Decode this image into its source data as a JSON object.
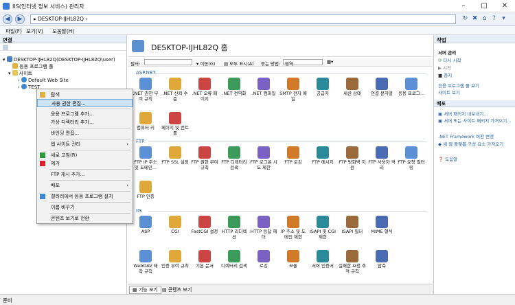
{
  "window": {
    "title": "IIS(인터넷 정보 서비스) 관리자",
    "minimize": "–",
    "maximize": "□",
    "close": "✕"
  },
  "address": {
    "path": "DESKTOP-IJHL82Q"
  },
  "menu": [
    "파일(F)",
    "보기(V)",
    "도움말(H)"
  ],
  "left": {
    "header": "연결",
    "tree": [
      "DESKTOP-IJHL82Q(DESKTOP-IJHL82Q\\user)",
      "응용 프로그램 풀",
      "사이트",
      "Default Web Site",
      "TEST"
    ]
  },
  "context_menu": [
    "탐색",
    "사용 권한 편집...",
    "응용 프로그램 추가...",
    "가상 디렉터리 추가...",
    "바인딩 편집...",
    "웹 사이트 관리",
    "새로 고침(R)",
    "제거",
    "FTP 게시 추가...",
    "배포",
    "갤러리에서 응용 프로그램 설치",
    "이름 바꾸기",
    "콘텐츠 보기로 전환"
  ],
  "center": {
    "title": "DESKTOP-IJHL82Q 홈",
    "filter": {
      "label": "필터:",
      "go": "이동(G)",
      "showall": "모두 표시(A)",
      "group_label": "묶는 방법:",
      "group_value": "영역"
    },
    "groups": {
      "aspnet": "ASP.NET",
      "ftp": "FTP",
      "iis": "IIS"
    },
    "aspnet_items": [
      ".NET 권한 부여 규칙",
      ".NET 신뢰 수준",
      ".NET 오류 페이지",
      ".NET 전역화",
      ".NET 컴파일",
      "SMTP 전자 메일",
      "공급자",
      "세션 상태",
      "연결 문자열",
      "응용 프로그...",
      "컴퓨터 키",
      "페이지 및 컨트롤"
    ],
    "ftp_items": [
      "FTP IP 주소 및 도메인...",
      "FTP SSL 설정",
      "FTP 권한 부여 규칙",
      "FTP 디렉터리 검색",
      "FTP 로그온 시도 제한",
      "FTP 로깅",
      "FTP 메시지",
      "FTP 방화벽 지원",
      "FTP 사용자 격리",
      "FTP 요청 필터링",
      "FTP 인증"
    ],
    "iis_items": [
      "ASP",
      "CGI",
      "FastCGI 설정",
      "HTTP 리디렉션",
      "HTTP 응답 헤더",
      "IP 주소 및 도메인 제한",
      "ISAPI 및 CGI 제한",
      "ISAPI 필터",
      "MIME 형식",
      "WebDAV 제작 규칙",
      "인증 부여 규칙",
      "기본 문서",
      "디렉터리 검색",
      "로깅",
      "모듈",
      "서버 인증서",
      "실패한 요청 추적 규칙",
      "압축"
    ],
    "tabs": [
      "기능 보기",
      "콘텐츠 보기"
    ]
  },
  "right": {
    "header": "작업",
    "sec1": "서버 관리",
    "restart": "다시 시작",
    "start": "시작",
    "stop": "중지",
    "pool_defaults": "응용 프로그램 풀 보기",
    "sites": "사이트 보기",
    "sec2": "배포",
    "export_pkg": "서버 패키지 내보내기...",
    "install_pkg": "서버 또는 사이트 패키지 가져오기...",
    "netfx": ".NET Framework 버전 변경",
    "newpool": "새 웹 플랫폼 구성 요소 가져오기",
    "help": "도움말"
  },
  "status": "준비"
}
